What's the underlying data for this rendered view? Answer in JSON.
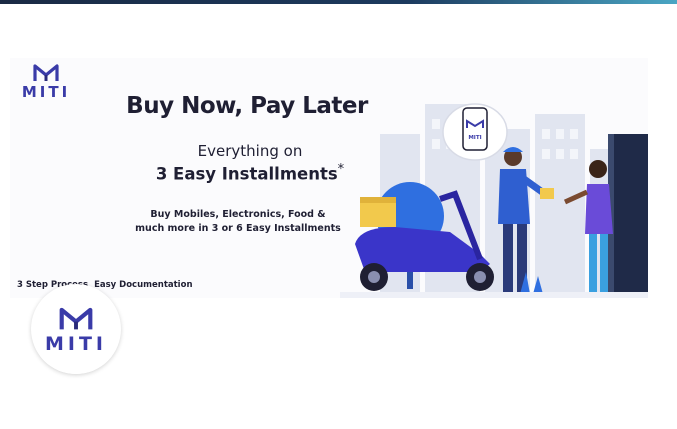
{
  "brand": {
    "name": "MITI"
  },
  "banner": {
    "headline": "Buy Now, Pay Later",
    "subline1": "Everything on",
    "subline2": "3 Easy Installments",
    "asterisk": "*",
    "desc_line1": "Buy Mobiles, Electronics, Food &",
    "desc_line2": "much more in 3 or 6 Easy Installments",
    "features": [
      "3 Step Process",
      "Easy Documentation"
    ],
    "phone_screen_brand": "MITI"
  },
  "colors": {
    "brand_purple": "#3a3ba8",
    "headline": "#1f1f33",
    "scooter": "#3a35c9",
    "box": "#f2c94c",
    "tree": "#2f6fe0",
    "building": "#cfd5e6",
    "door": "#1f2a48"
  },
  "icons": [
    "miti-logo-icon",
    "phone-icon",
    "scooter-icon",
    "delivery-box-icon",
    "tree-icon",
    "city-buildings-icon"
  ]
}
